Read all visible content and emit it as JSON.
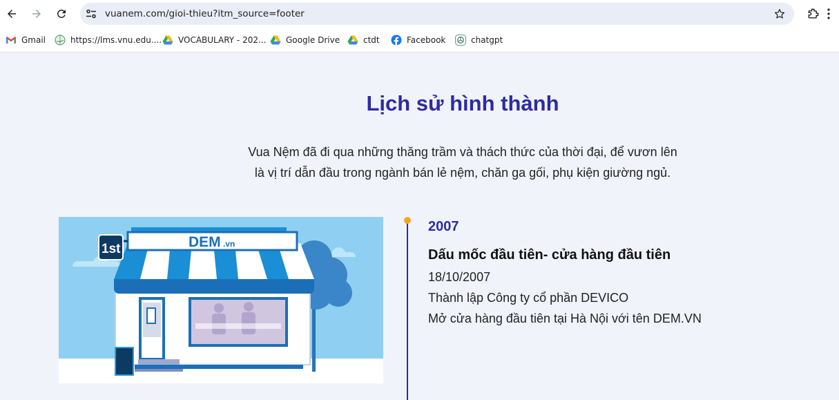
{
  "browser": {
    "url": "vuanem.com/gioi-thieu?itm_source=footer",
    "bookmarks": [
      {
        "label": "Gmail",
        "icon": "gmail-icon"
      },
      {
        "label": "https://lms.vnu.edu....",
        "icon": "globe-icon"
      },
      {
        "label": "VOCABULARY - 202...",
        "icon": "google-drive-icon"
      },
      {
        "label": "Google Drive",
        "icon": "google-drive-icon"
      },
      {
        "label": "ctdt",
        "icon": "google-drive-icon"
      },
      {
        "label": "Facebook",
        "icon": "facebook-icon"
      },
      {
        "label": "chatgpt",
        "icon": "chatgpt-icon"
      }
    ]
  },
  "page": {
    "title": "Lịch sử hình thành",
    "intro_line1": "Vua Nệm đã đi qua những thăng trầm và thách thức của thời đại, để vươn lên",
    "intro_line2": "là vị trí dẫn đầu trong ngành bán lẻ nệm, chăn ga gối, phụ kiện giường ngủ.",
    "colors": {
      "heading": "#2e2ba3",
      "accent_dot": "#f5a524",
      "background": "#f1f3fb"
    },
    "timeline": {
      "year": "2007",
      "heading": "Dấu mốc đầu tiên- cửa hàng đầu tiên",
      "date": "18/10/2007",
      "line1": "Thành lập Công ty cổ phần DEVICO",
      "line2": "Mở cửa hàng đầu tiên tại Hà Nội với tên DEM.VN"
    },
    "illustration": {
      "badge": "1st",
      "sign_text": "DEM",
      "sign_suffix": ".vn"
    }
  }
}
